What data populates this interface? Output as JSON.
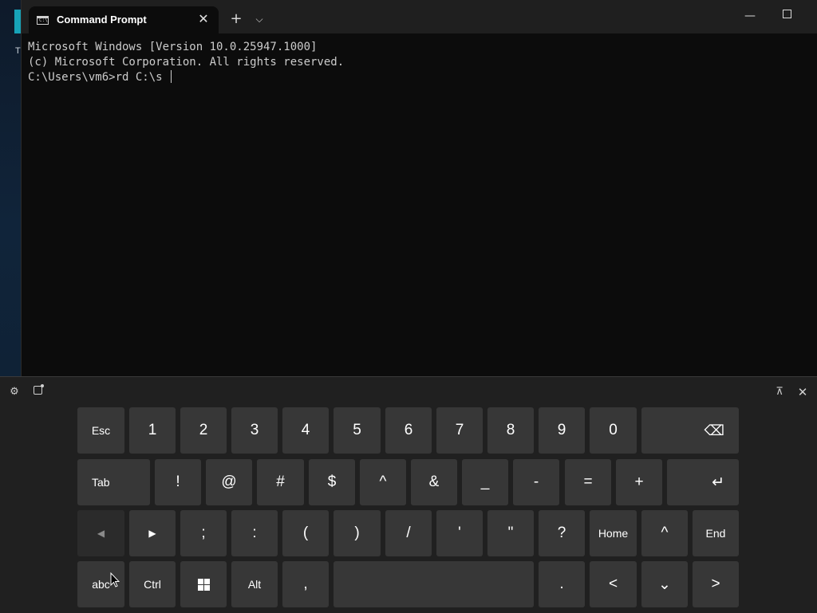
{
  "desktop": {
    "edge_text": "T"
  },
  "terminal": {
    "tab_title": "Command Prompt",
    "tab_icon_text": "C:\\",
    "tab_close": "✕",
    "new_tab": "+",
    "tab_dropdown": "⌵",
    "minimize": "—",
    "lines": [
      "Microsoft Windows [Version 10.0.25947.1000]",
      "(c) Microsoft Corporation. All rights reserved.",
      "",
      "C:\\Users\\vm6>rd C:\\s "
    ]
  },
  "keyboard": {
    "toolbar": {
      "settings": "⚙",
      "dock": "⊼",
      "close": "✕"
    },
    "row1": [
      "Esc",
      "1",
      "2",
      "3",
      "4",
      "5",
      "6",
      "7",
      "8",
      "9",
      "0",
      "⌫"
    ],
    "row2": [
      "Tab",
      "!",
      "@",
      "#",
      "$",
      "^",
      "&",
      "_",
      "-",
      "=",
      "+",
      "↵"
    ],
    "row3": [
      "◀",
      "▶",
      ";",
      ":",
      "(",
      ")",
      "/",
      "'",
      "\"",
      "?",
      "Home",
      "^",
      "End"
    ],
    "row4": [
      "abc",
      "Ctrl",
      "",
      "Alt",
      ",",
      "",
      ".",
      "<",
      "⌄",
      ">"
    ]
  },
  "colors": {
    "terminal_bg": "#0c0c0c",
    "titlebar_bg": "#1f1f1f",
    "key_bg": "#373737",
    "keyboard_bg": "#202020"
  },
  "icons": {
    "tab": "command-prompt-icon",
    "settings": "gear-icon",
    "emoji": "emoji-icon",
    "dock": "dock-icon",
    "close": "close-icon",
    "windows": "windows-logo-icon"
  }
}
